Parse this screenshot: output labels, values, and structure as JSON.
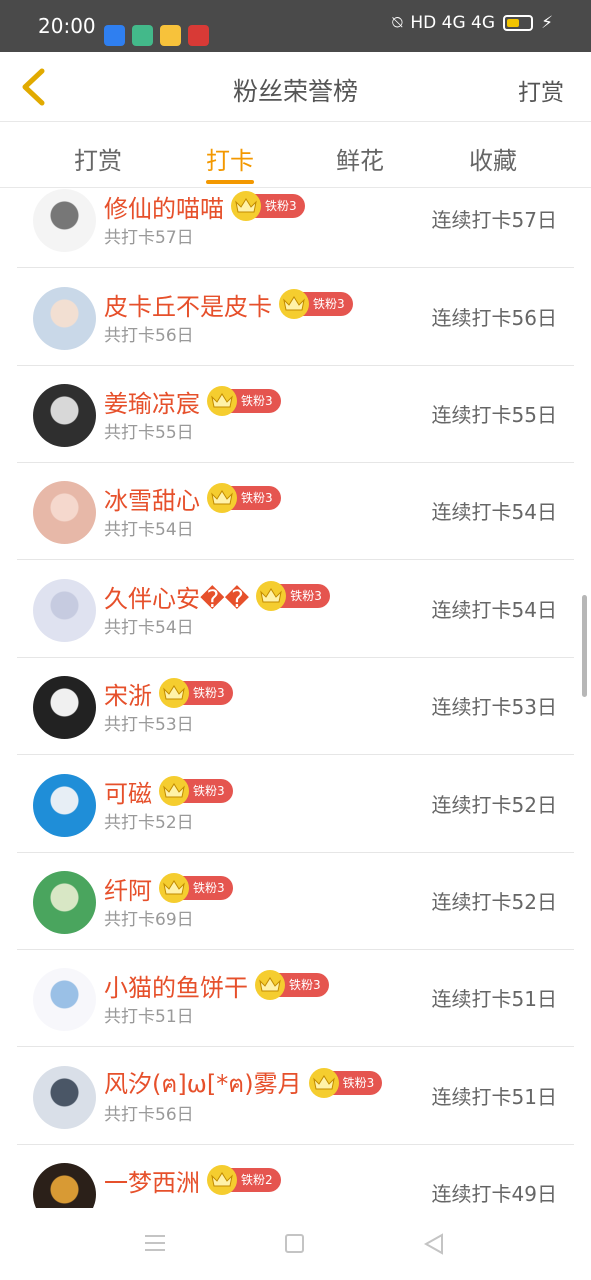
{
  "status": {
    "time": "20:00",
    "indicators": "HD 4G 4G",
    "apps": [
      {
        "name": "blue-app-icon",
        "color": "#2f7ff0"
      },
      {
        "name": "green-app-icon",
        "color": "#43b98a"
      },
      {
        "name": "meituan-app-icon",
        "color": "#f7c23b"
      },
      {
        "name": "red-app-icon",
        "color": "#d83a36"
      }
    ]
  },
  "header": {
    "title": "粉丝荣誉榜",
    "action": "打赏"
  },
  "tabs": [
    "打赏",
    "打卡",
    "鲜花",
    "收藏"
  ],
  "active_tab": 1,
  "list": [
    {
      "name": "修仙的喵喵",
      "level": "铁粉3",
      "total": "共打卡57日",
      "streak": "连续打卡57日",
      "avatar": [
        "#f4f4f4",
        "#777777"
      ]
    },
    {
      "name": "皮卡丘不是皮卡",
      "level": "铁粉3",
      "total": "共打卡56日",
      "streak": "连续打卡56日",
      "avatar": [
        "#c9d8e8",
        "#f2dfd2"
      ]
    },
    {
      "name": "姜瑜凉宸",
      "level": "铁粉3",
      "total": "共打卡55日",
      "streak": "连续打卡55日",
      "avatar": [
        "#2f2f2f",
        "#d8d8d8"
      ]
    },
    {
      "name": "冰雪甜心",
      "level": "铁粉3",
      "total": "共打卡54日",
      "streak": "连续打卡54日",
      "avatar": [
        "#e7b8a8",
        "#f5d8cd"
      ]
    },
    {
      "name": "久伴心安��",
      "level": "铁粉3",
      "total": "共打卡54日",
      "streak": "连续打卡54日",
      "avatar": [
        "#dfe2f0",
        "#c6cbe0"
      ]
    },
    {
      "name": "宋浙",
      "level": "铁粉3",
      "total": "共打卡53日",
      "streak": "连续打卡53日",
      "avatar": [
        "#222222",
        "#f0f0f0"
      ]
    },
    {
      "name": "可磁",
      "level": "铁粉3",
      "total": "共打卡52日",
      "streak": "连续打卡52日",
      "avatar": [
        "#1f8ed8",
        "#e7eef5"
      ]
    },
    {
      "name": "纤阿",
      "level": "铁粉3",
      "total": "共打卡69日",
      "streak": "连续打卡52日",
      "avatar": [
        "#4aa55e",
        "#d8e7c5"
      ]
    },
    {
      "name": "小猫的鱼饼干",
      "level": "铁粉3",
      "total": "共打卡51日",
      "streak": "连续打卡51日",
      "avatar": [
        "#f7f7fb",
        "#9ac0e6"
      ]
    },
    {
      "name": "风汐(ฅ]ω[*ฅ)雾月",
      "level": "铁粉3",
      "total": "共打卡56日",
      "streak": "连续打卡51日",
      "avatar": [
        "#d9dfe8",
        "#4a5666"
      ]
    },
    {
      "name": "一梦西洲",
      "level": "铁粉2",
      "total": "",
      "streak": "连续打卡49日",
      "avatar": [
        "#2b2019",
        "#d89a34"
      ]
    }
  ]
}
